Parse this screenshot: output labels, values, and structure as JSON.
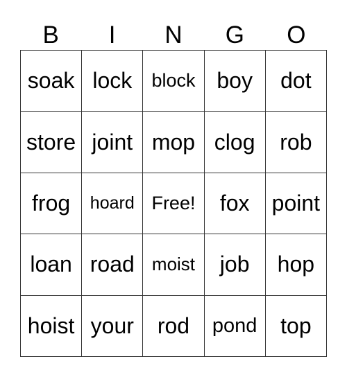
{
  "header": [
    "B",
    "I",
    "N",
    "G",
    "O"
  ],
  "rows": [
    [
      "soak",
      "lock",
      "block",
      "boy",
      "dot"
    ],
    [
      "store",
      "joint",
      "mop",
      "clog",
      "rob"
    ],
    [
      "frog",
      "hoard",
      "Free!",
      "fox",
      "point"
    ],
    [
      "loan",
      "road",
      "moist",
      "job",
      "hop"
    ],
    [
      "hoist",
      "your",
      "rod",
      "pond",
      "top"
    ]
  ]
}
